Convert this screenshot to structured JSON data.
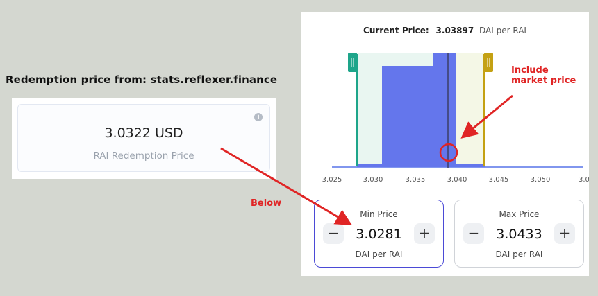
{
  "heading": "Redemption price from: stats.reflexer.finance",
  "redemption": {
    "value": "3.0322 USD",
    "label": "RAI Redemption Price",
    "info_icon": "info-icon"
  },
  "range": {
    "current_price_label": "Current Price:",
    "current_price_value": "3.03897",
    "current_price_unit": "DAI per RAI",
    "axis_ticks": [
      "3.025",
      "3.030",
      "3.035",
      "3.040",
      "3.045",
      "3.050",
      "3.0"
    ],
    "min": {
      "title": "Min Price",
      "value": "3.0281",
      "unit": "DAI per RAI",
      "decrement": "−",
      "increment": "+"
    },
    "max": {
      "title": "Max Price",
      "value": "3.0433",
      "unit": "DAI per RAI",
      "decrement": "−",
      "increment": "+"
    }
  },
  "annotations": {
    "below": "Below",
    "include_line1": "Include",
    "include_line2": "market price"
  },
  "colors": {
    "liquidity": "#6476ec",
    "range_fill": "#e9f6f1",
    "max_fill": "#f4f7e6",
    "min_handle": "#1ea58a",
    "max_handle": "#c4a113",
    "current_line": "#3b3f66",
    "annotation": "#e02525",
    "min_box_border": "#4b4ad6"
  }
}
